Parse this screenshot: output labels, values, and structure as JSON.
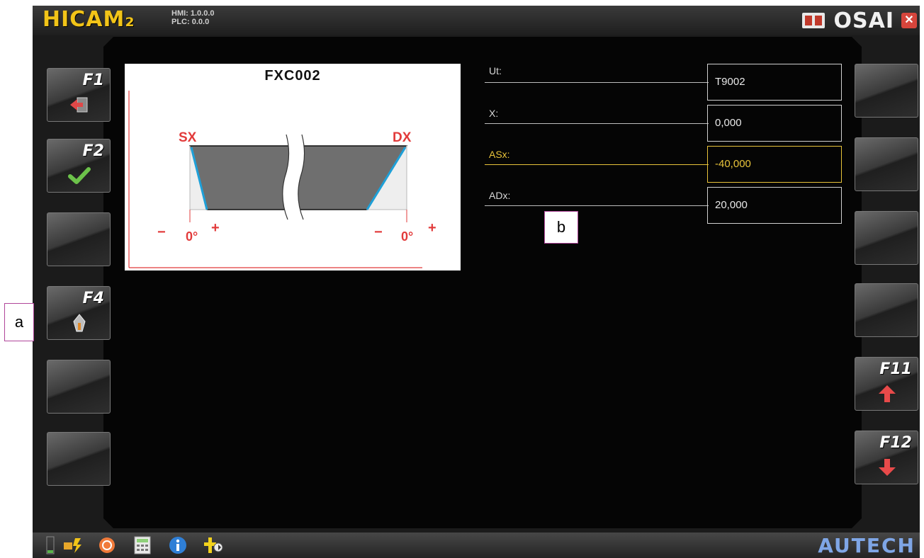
{
  "header": {
    "app_title": "HICAM₂",
    "hmi_version": "HMI: 1.0.0.0",
    "plc_version": "PLC: 0.0.0",
    "brand_logo": "OSAI"
  },
  "drawing": {
    "title": "FXC002",
    "left_label": "SX",
    "right_label": "DX",
    "left_minus": "−",
    "left_zero": "0°",
    "left_plus": "+",
    "right_minus": "−",
    "right_zero": "0°",
    "right_plus": "+"
  },
  "fields": [
    {
      "label": "Ut:",
      "value": "T9002",
      "active": false
    },
    {
      "label": "X:",
      "value": "0,000",
      "active": false
    },
    {
      "label": "ASx:",
      "value": "-40,000",
      "active": true
    },
    {
      "label": "ADx:",
      "value": "20,000",
      "active": false
    }
  ],
  "fkeys_left": [
    {
      "label": "F1",
      "icon": "exit-arrow-icon"
    },
    {
      "label": "F2",
      "icon": "checkmark-icon"
    },
    {
      "label": "",
      "icon": ""
    },
    {
      "label": "F4",
      "icon": "tool-icon"
    },
    {
      "label": "",
      "icon": ""
    },
    {
      "label": "",
      "icon": ""
    }
  ],
  "fkeys_right": [
    {
      "label": "",
      "icon": ""
    },
    {
      "label": "",
      "icon": ""
    },
    {
      "label": "",
      "icon": ""
    },
    {
      "label": "",
      "icon": ""
    },
    {
      "label": "F11",
      "icon": "arrow-up-icon"
    },
    {
      "label": "F12",
      "icon": "arrow-down-icon"
    }
  ],
  "callouts": {
    "a": "a",
    "b": "b"
  },
  "toolbar": {
    "icons": [
      "battery-icon",
      "power-plug-icon",
      "power-button-icon",
      "calculator-icon",
      "info-icon",
      "tool-setup-icon"
    ],
    "brand": "AUTECH"
  },
  "colors": {
    "accent_yellow": "#e8c33a",
    "drawing_red": "#e23b3b",
    "edge_blue": "#1ea0d8",
    "background": "#050505"
  }
}
